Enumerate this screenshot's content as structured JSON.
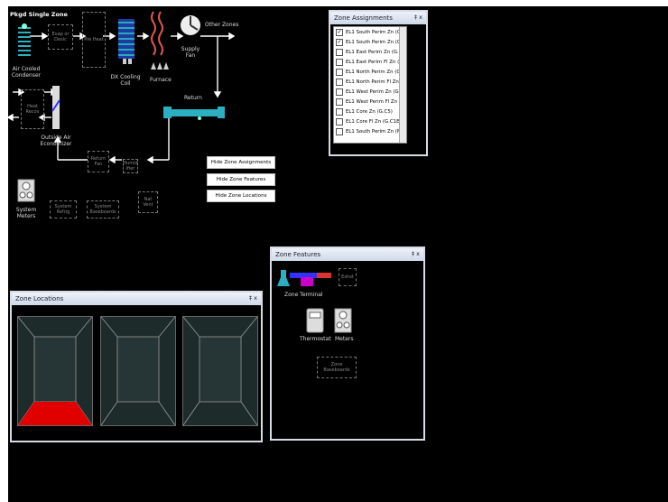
{
  "system": {
    "title": "Pkgd Single Zone",
    "condenser_label": "Air Cooled Condenser",
    "evap_label": "Evap or Desic",
    "preheat_label": "Pre Heat",
    "dx_label": "DX Cooling Coil",
    "furnace_label": "Furnace",
    "supply_fan_label": "Supply Fan",
    "other_zones_label": "Other Zones",
    "return_label": "Return",
    "heat_recov_label": "Heat Recov",
    "economizer_label": "Outside Air Economizer",
    "return_fan_label": "Return Fan",
    "humidifier_label": "Humid ifier",
    "system_meters_label": "System Meters",
    "system_refrig_label": "System Refrig",
    "system_baseboards_label": "System Baseboards",
    "nat_vent_label": "Nat Vent"
  },
  "buttons": {
    "hide_assignments": "Hide Zone Assignments",
    "hide_features": "Hide Zone Features",
    "hide_locations": "Hide Zone Locations"
  },
  "zone_assignments": {
    "title": "Zone Assignments",
    "controls": "‡ x",
    "items": [
      {
        "label": "EL1 South Perim Zn (G",
        "checked": true
      },
      {
        "label": "EL1 South Perim Zn (G",
        "checked": true
      },
      {
        "label": "EL1 East Perim Zn (G.E",
        "checked": false
      },
      {
        "label": "EL1 East Perim Fl Zn (G",
        "checked": false
      },
      {
        "label": "EL1 North Perim Zn (G.",
        "checked": false
      },
      {
        "label": "EL1 North Perim Fl Zn (",
        "checked": false
      },
      {
        "label": "EL1 West Perim Zn (G.W",
        "checked": false
      },
      {
        "label": "EL1 West Perim Fl Zn (G",
        "checked": false
      },
      {
        "label": "EL1 Core Zn (G.C5)",
        "checked": false
      },
      {
        "label": "EL1 Core Fl Zn (G.C1E)",
        "checked": false
      },
      {
        "label": "EL1 South Perim Zn (M.",
        "checked": false
      }
    ]
  },
  "zone_features": {
    "title": "Zone Features",
    "controls": "‡ x",
    "zone_terminal_label": "Zone Terminal",
    "exhst_label": "Exhst",
    "thermostat_label": "Thermostat",
    "meters_label": "Meters",
    "zone_baseboards_label": "Zone Baseboards"
  },
  "zone_locations": {
    "title": "Zone Locations",
    "controls": "‡ x"
  },
  "colors": {
    "highlight": "#e00000",
    "accent": "#2ab0c0"
  }
}
